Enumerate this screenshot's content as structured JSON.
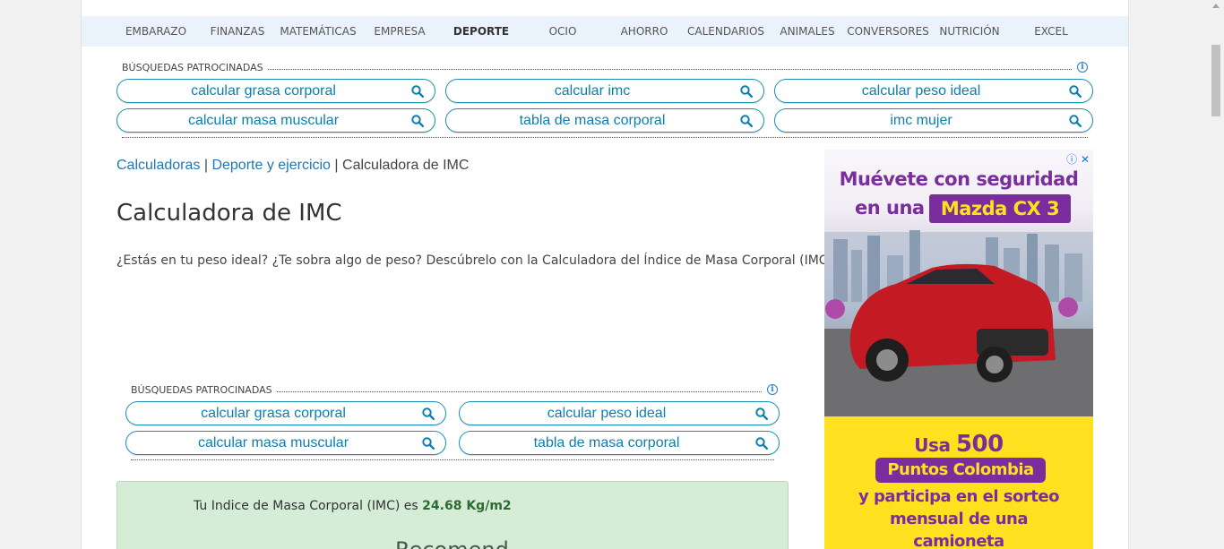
{
  "nav": {
    "items": [
      "EMBARAZO",
      "FINANZAS",
      "MATEMÁTICAS",
      "EMPRESA",
      "DEPORTE",
      "OCIO",
      "AHORRO",
      "CALENDARIOS",
      "ANIMALES",
      "CONVERSORES",
      "NUTRICIÓN",
      "EXCEL"
    ],
    "active": "DEPORTE"
  },
  "sponsored_top": {
    "title": "BÚSQUEDAS PATROCINADAS",
    "items": [
      "calcular grasa corporal",
      "calcular imc",
      "calcular peso ideal",
      "calcular masa muscular",
      "tabla de masa corporal",
      "imc mujer"
    ]
  },
  "breadcrumb": {
    "link1": "Calculadoras",
    "sep": "|",
    "link2": "Deporte y ejercicio",
    "current": "Calculadora de IMC"
  },
  "page_title": "Calculadora de IMC",
  "intro": "¿Estás en tu peso ideal? ¿Te sobra algo de peso? Descúbrelo con la Calculadora del Índice de Masa Corporal (IMC)",
  "sponsored_mid": {
    "title": "BÚSQUEDAS PATROCINADAS",
    "items": [
      "calcular grasa corporal",
      "calcular peso ideal",
      "calcular masa muscular",
      "tabla de masa corporal"
    ]
  },
  "result": {
    "prefix": "Tu Indice de Masa Corporal (IMC) es",
    "value": "24.68 Kg/m2",
    "partial": "Recomend"
  },
  "ad": {
    "headline1": "Muévete con seguridad",
    "headline2": "en una",
    "brand": "Mazda CX 3",
    "usa": "Usa",
    "points": "500",
    "points_label": "Puntos Colombia",
    "line3": "y participa en el sorteo",
    "line4": "mensual de una",
    "line5": "camioneta"
  },
  "colors": {
    "accent": "#0b7fad",
    "link": "#1f77b4",
    "nav_bg": "#eaf3fb",
    "result_bg": "#d5ecd7",
    "ad_purple": "#7a2d9c",
    "ad_yellow": "#ffe11f"
  },
  "icons": [
    "search-icon",
    "info-icon",
    "adchoices-icon",
    "close-icon"
  ]
}
